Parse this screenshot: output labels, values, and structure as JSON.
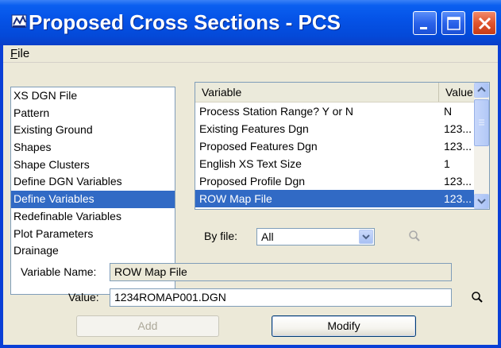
{
  "window": {
    "title": "Proposed Cross Sections - PCS",
    "minimize_icon": "minimize-icon",
    "maximize_icon": "maximize-icon",
    "close_icon": "close-icon"
  },
  "menu": {
    "file_first": "F",
    "file_rest": "ile"
  },
  "sections": {
    "items": [
      {
        "label": "XS DGN File",
        "selected": false
      },
      {
        "label": "Pattern",
        "selected": false
      },
      {
        "label": "Existing Ground",
        "selected": false
      },
      {
        "label": "Shapes",
        "selected": false
      },
      {
        "label": "Shape Clusters",
        "selected": false
      },
      {
        "label": "Define DGN Variables",
        "selected": false
      },
      {
        "label": "Define Variables",
        "selected": true
      },
      {
        "label": "Redefinable Variables",
        "selected": false
      },
      {
        "label": "Plot Parameters",
        "selected": false
      },
      {
        "label": "Drainage",
        "selected": false
      }
    ]
  },
  "variables_table": {
    "columns": [
      "Variable",
      "Value"
    ],
    "rows": [
      {
        "variable": "Process Station Range? Y or N",
        "value": "N",
        "selected": false
      },
      {
        "variable": "Existing Features Dgn",
        "value": "123...",
        "selected": false
      },
      {
        "variable": "Proposed Features Dgn",
        "value": "123...",
        "selected": false
      },
      {
        "variable": "English XS Text Size",
        "value": "1",
        "selected": false
      },
      {
        "variable": "Proposed Profile Dgn",
        "value": "123...",
        "selected": false
      },
      {
        "variable": "ROW Map File",
        "value": "123...",
        "selected": true
      }
    ]
  },
  "filter": {
    "label": "By file:",
    "selected": "All",
    "search_icon": "magnifier-icon"
  },
  "form": {
    "variable_name_label": "Variable Name:",
    "variable_name_value": "ROW Map File",
    "value_label": "Value:",
    "value_value": "1234ROMAP001.DGN",
    "browse_icon": "magnifier-icon"
  },
  "buttons": {
    "add": "Add",
    "modify": "Modify"
  },
  "colors": {
    "selection": "#316ac5",
    "face": "#ece9d8",
    "titlebar": "#0552e6"
  }
}
